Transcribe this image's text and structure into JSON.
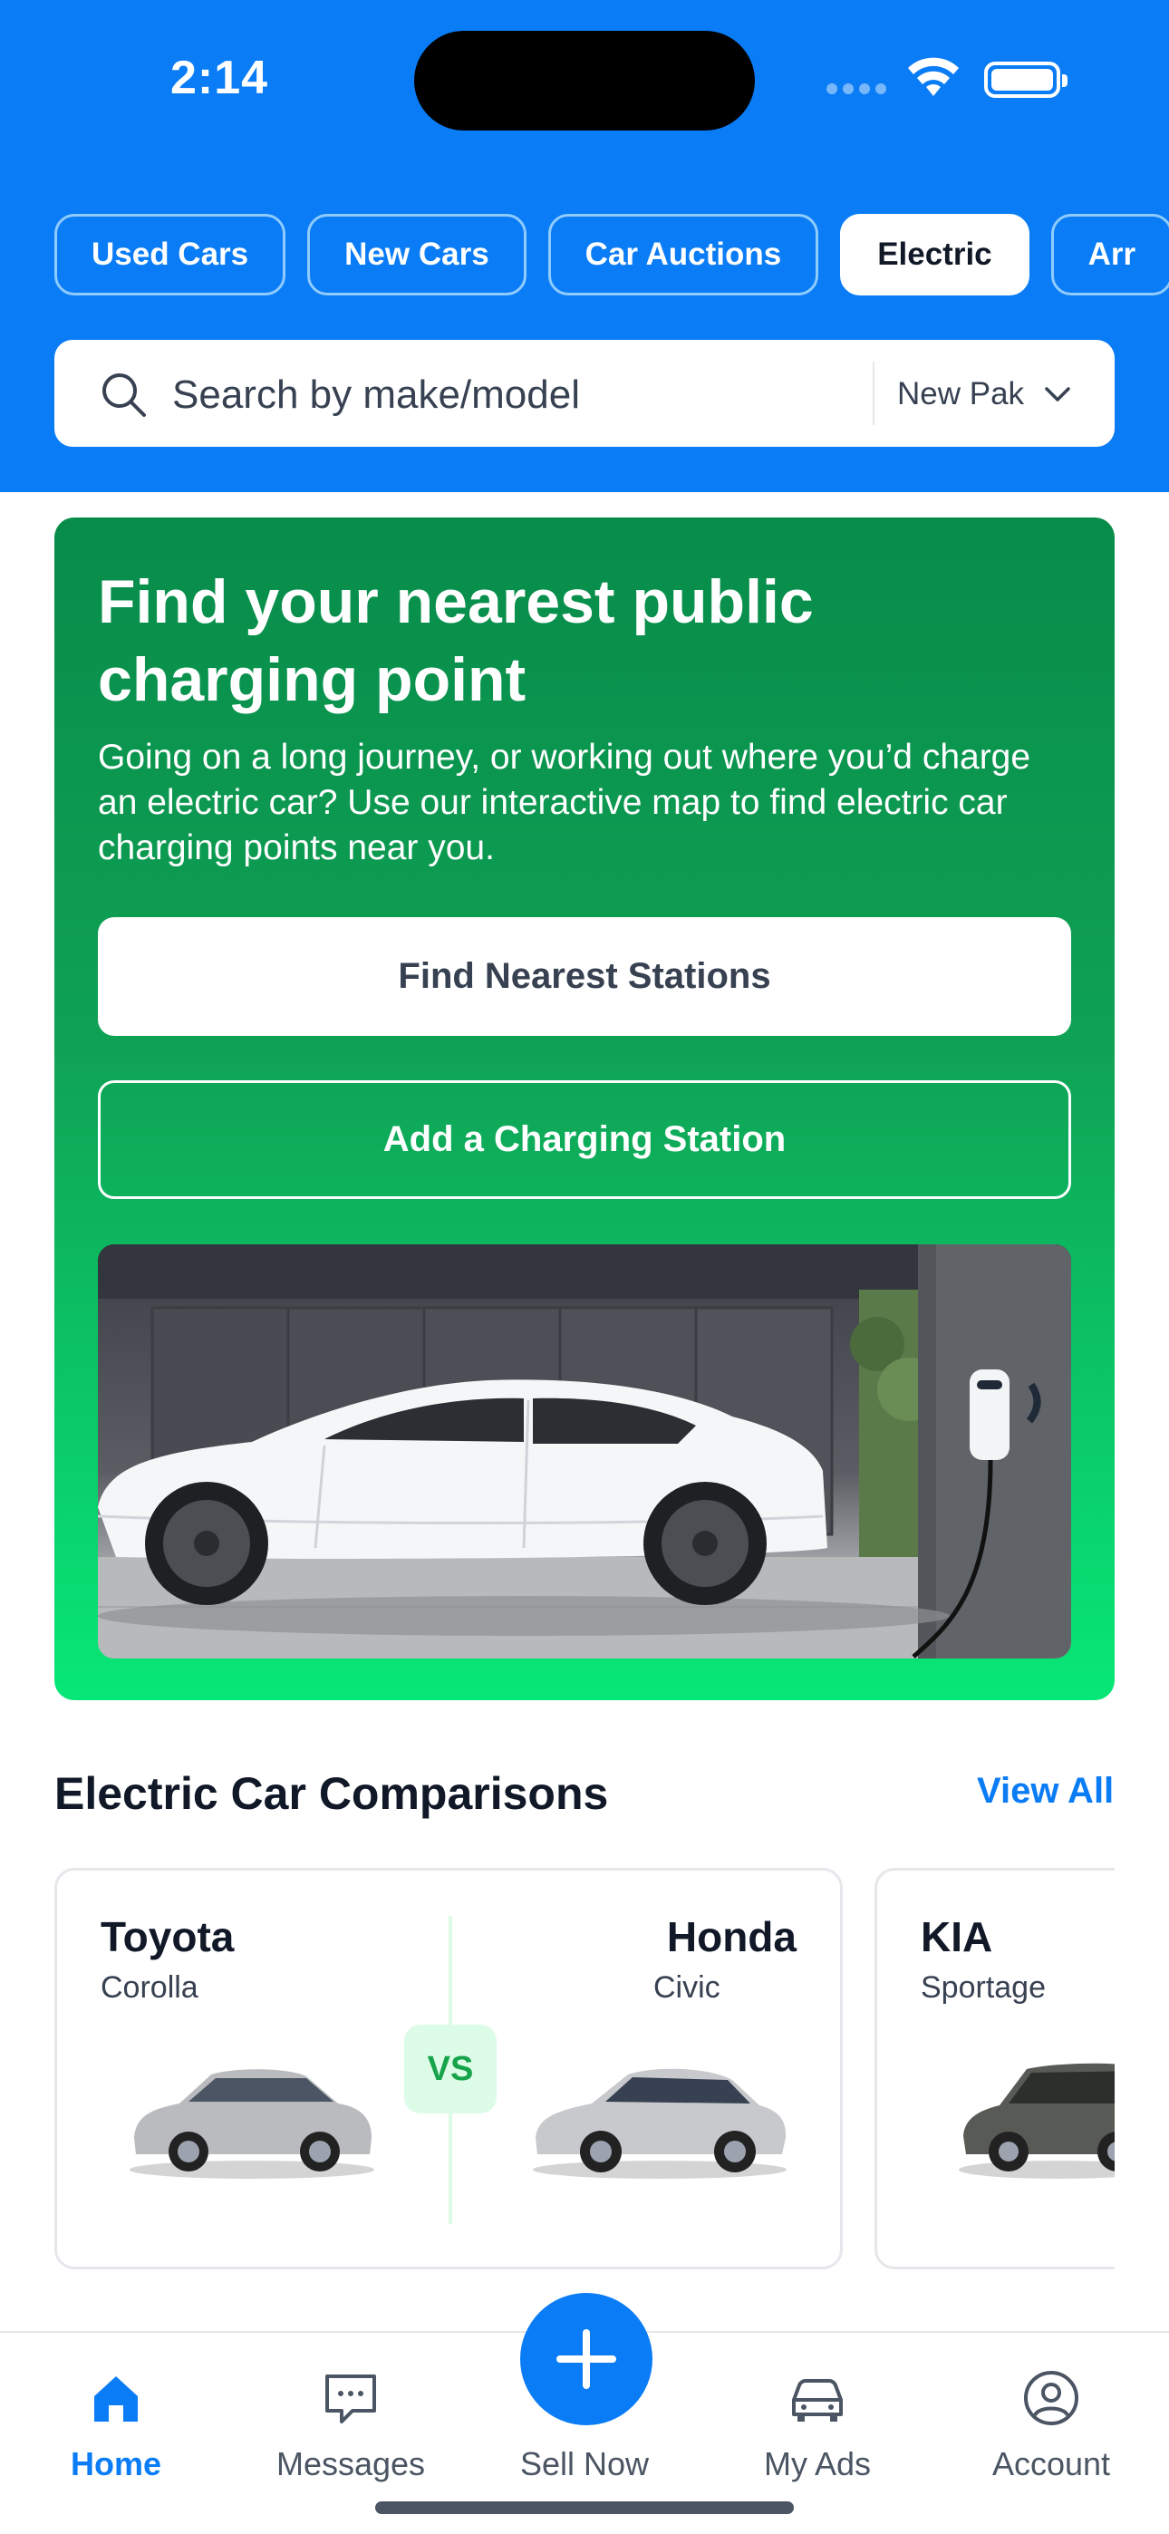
{
  "status_bar": {
    "time": "2:14"
  },
  "tabs": [
    {
      "label": "Used Cars"
    },
    {
      "label": "New Cars"
    },
    {
      "label": "Car Auctions"
    },
    {
      "label": "Electric"
    },
    {
      "label": "Arr"
    }
  ],
  "search": {
    "placeholder": "Search by make/model",
    "city": "New Pak"
  },
  "promo": {
    "title": "Find your nearest public charging point",
    "description": "Going on a long journey, or working out where you’d charge an electric car? Use our interactive map to find electric car charging points near you.",
    "primary_button": "Find Nearest Stations",
    "secondary_button": "Add a Charging Station"
  },
  "comparisons": {
    "title": "Electric Car Comparisons",
    "view_all": "View All",
    "vs_label": "VS",
    "cards": [
      {
        "left_make": "Toyota",
        "left_model": "Corolla",
        "right_make": "Honda",
        "right_model": "Civic"
      },
      {
        "left_make": "KIA",
        "left_model": "Sportage"
      }
    ]
  },
  "bottom_nav": {
    "items": [
      {
        "label": "Home",
        "icon": "home-icon"
      },
      {
        "label": "Messages",
        "icon": "messages-icon"
      },
      {
        "label": "Sell Now",
        "icon": "plus-icon"
      },
      {
        "label": "My Ads",
        "icon": "car-icon"
      },
      {
        "label": "Account",
        "icon": "account-icon"
      }
    ]
  },
  "colors": {
    "brand_blue": "#0a7cf5",
    "promo_green_dark": "#088c4a",
    "promo_green_light": "#07e777",
    "vs_green": "#16a34a"
  }
}
